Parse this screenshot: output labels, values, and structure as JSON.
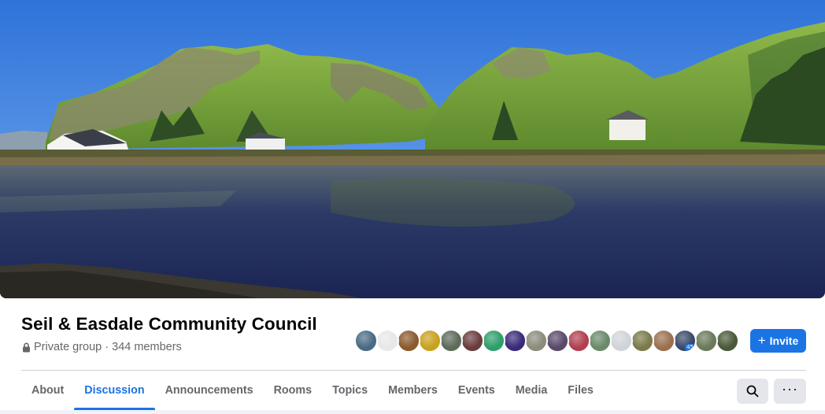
{
  "cover": {
    "image": "landscape-photo",
    "description_icon": "cover-photo"
  },
  "group": {
    "name": "Seil & Easdale Community Council",
    "meta": "Private group · 344 members",
    "privacy_icon": "lock-icon"
  },
  "members": {
    "avatars": [
      {
        "name": "member-avatar-1",
        "color": "#4a6b85"
      },
      {
        "name": "member-avatar-2",
        "color": "#e8e8e8"
      },
      {
        "name": "member-avatar-3",
        "color": "#8a5a2e"
      },
      {
        "name": "member-avatar-4",
        "color": "#c8a21e"
      },
      {
        "name": "member-avatar-5",
        "color": "#5d6b5a"
      },
      {
        "name": "member-avatar-6",
        "color": "#6a3d3d"
      },
      {
        "name": "member-avatar-7",
        "color": "#2e9e6b"
      },
      {
        "name": "member-avatar-8",
        "color": "#3a2a7a"
      },
      {
        "name": "member-avatar-9",
        "color": "#8c8c7c"
      },
      {
        "name": "member-avatar-10",
        "color": "#5a4a6a"
      },
      {
        "name": "member-avatar-11",
        "color": "#b04050"
      },
      {
        "name": "member-avatar-12",
        "color": "#6a8a6a"
      },
      {
        "name": "member-avatar-13",
        "color": "#d0d3d8"
      },
      {
        "name": "member-avatar-14",
        "color": "#7a7a4a"
      },
      {
        "name": "member-avatar-15",
        "color": "#9a7050"
      },
      {
        "name": "member-avatar-16",
        "color": "#3a4a6a"
      },
      {
        "name": "member-avatar-17",
        "color": "#6a7a5a"
      },
      {
        "name": "member-avatar-18",
        "color": "#4a5a3a"
      }
    ],
    "badge_text": "45"
  },
  "actions": {
    "invite_label": "Invite"
  },
  "tabs": [
    {
      "label": "About",
      "active": false
    },
    {
      "label": "Discussion",
      "active": true
    },
    {
      "label": "Announcements",
      "active": false
    },
    {
      "label": "Rooms",
      "active": false
    },
    {
      "label": "Topics",
      "active": false
    },
    {
      "label": "Members",
      "active": false
    },
    {
      "label": "Events",
      "active": false
    },
    {
      "label": "Media",
      "active": false
    },
    {
      "label": "Files",
      "active": false
    }
  ],
  "toolbar": {
    "search_icon": "search-icon",
    "more_icon": "more-options-icon",
    "more_label": "···"
  },
  "colors": {
    "accent": "#1b74e4",
    "text_primary": "#050505",
    "text_secondary": "#65676b",
    "button_gray": "#e4e6eb"
  }
}
